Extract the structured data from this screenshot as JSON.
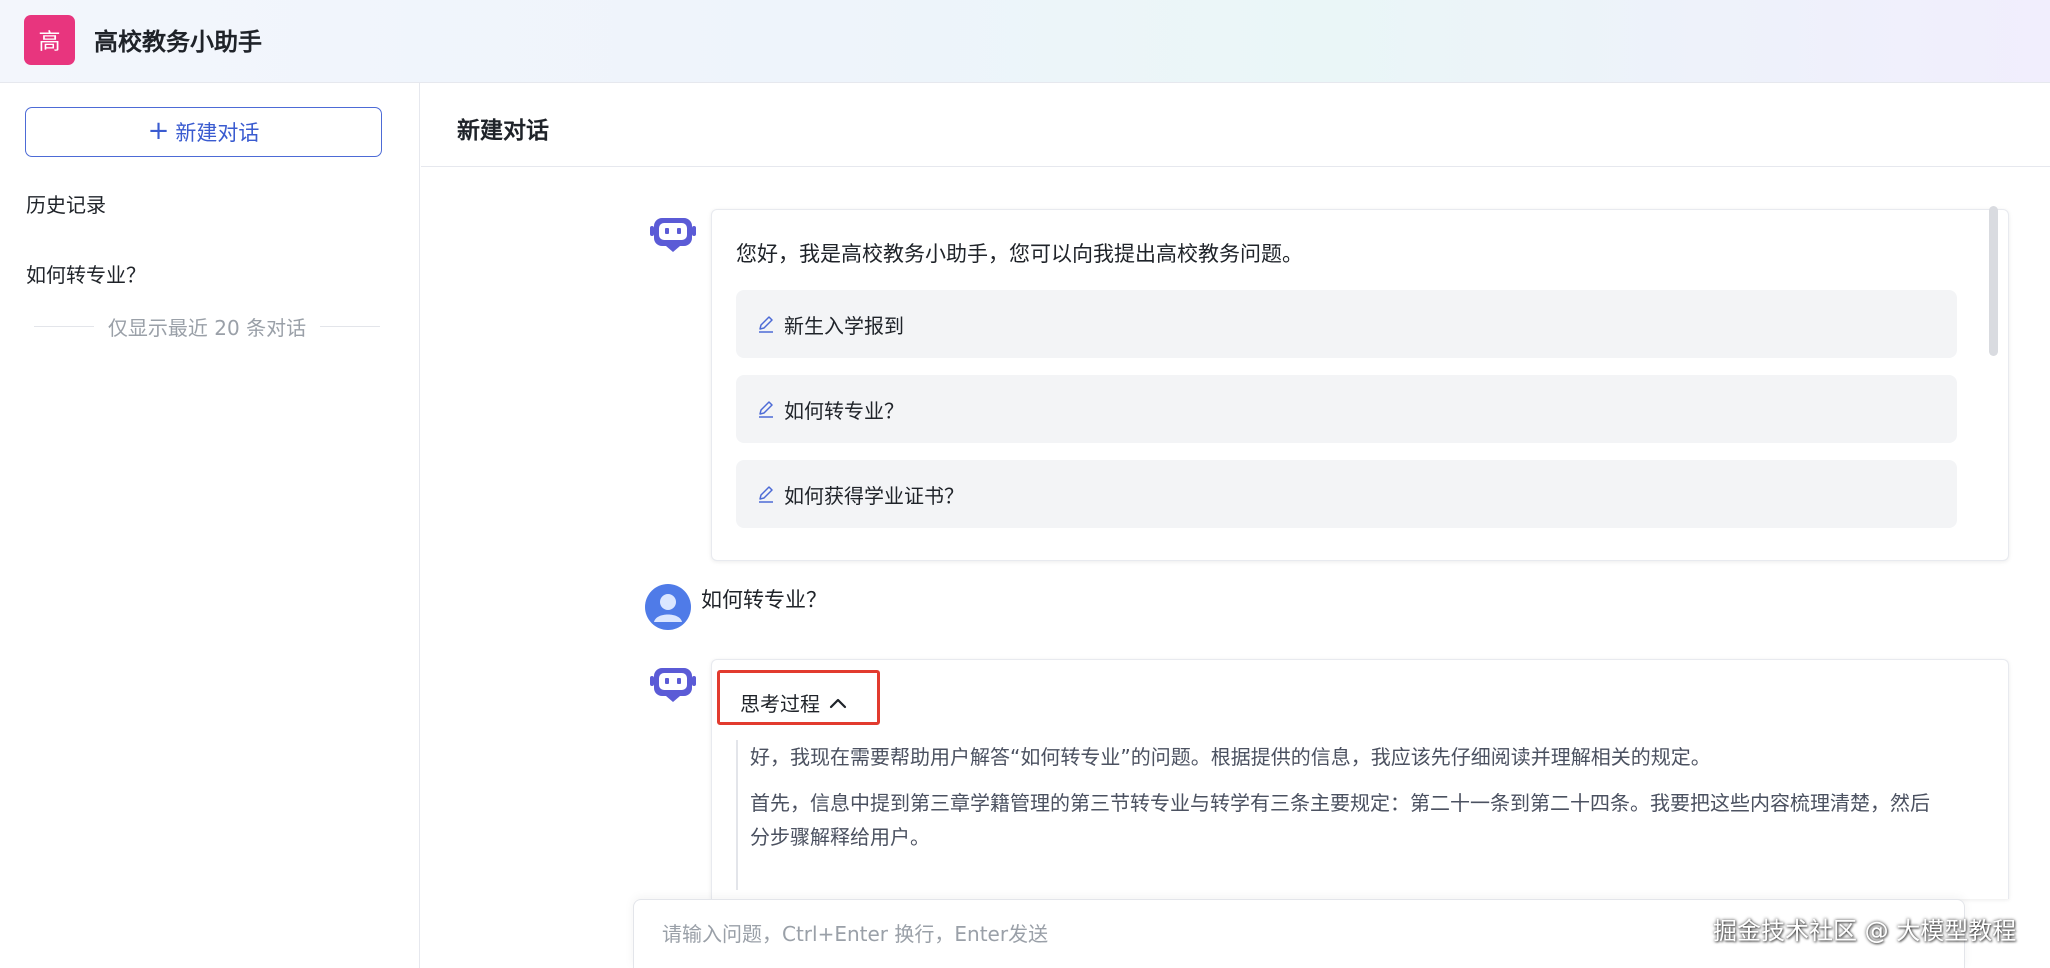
{
  "app": {
    "logo_char": "高",
    "title": "高校教务小助手"
  },
  "sidebar": {
    "new_chat_label": "新建对话",
    "history_label": "历史记录",
    "history_items": [
      {
        "label": "如何转专业？"
      }
    ],
    "recent_note": "仅显示最近 20 条对话"
  },
  "main": {
    "title": "新建对话",
    "welcome": {
      "text": "您好，我是高校教务小助手，您可以向我提出高校教务问题。",
      "suggestions": [
        {
          "label": "新生入学报到"
        },
        {
          "label": "如何转专业？"
        },
        {
          "label": "如何获得学业证书？"
        }
      ]
    },
    "user_message": "如何转专业？",
    "answer": {
      "think_toggle_label": "思考过程",
      "thinking_paragraphs": [
        "好，我现在需要帮助用户解答“如何转专业”的问题。根据提供的信息，我应该先仔细阅读并理解相关的规定。",
        "首先，信息中提到第三章学籍管理的第三节转专业与转学有三条主要规定：第二十一条到第二十四条。我要把这些内容梳理清楚，然后分步骤解释给用户。"
      ]
    }
  },
  "input": {
    "placeholder": "请输入问题，Ctrl+Enter 换行，Enter发送"
  },
  "watermark": "掘金技术社区 @ 大模型教程",
  "colors": {
    "accent": "#3a5bd0",
    "logo_bg": "#e8357e",
    "highlight": "#e23b2f"
  }
}
